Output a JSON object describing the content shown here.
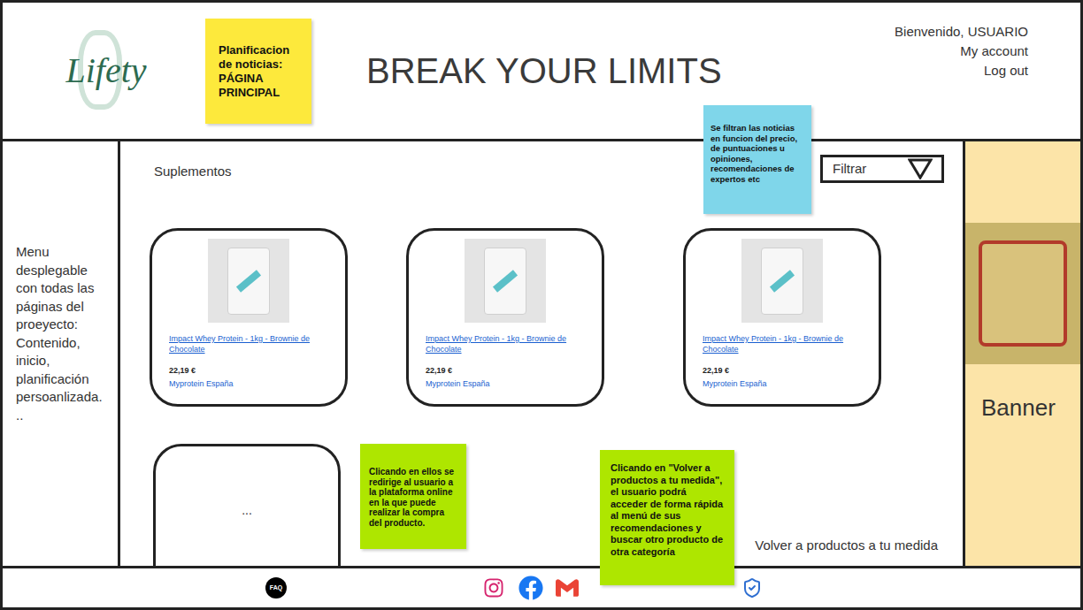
{
  "header": {
    "logo": "Lifety",
    "note": "Planificacion de noticias: PÁGINA PRINCIPAL",
    "title": "BREAK YOUR LIMITS",
    "user_menu": [
      "Bienvenido, USUARIO",
      "My account",
      "Log out"
    ]
  },
  "sidebar": {
    "text": "Menu desplegable con todas las páginas del proeyecto: Contenido, inicio, planificación persoanlizada. .."
  },
  "main": {
    "section": "Suplementos",
    "filter": {
      "label": "Filtrar"
    },
    "filter_note": "Se filtran las noticias en funcion del precio, de puntuaciones u opiniones, recomendaciones de expertos etc",
    "products": [
      {
        "name": "Impact Whey Protein - 1kg - Brownie de Chocolate",
        "price": "22,19 €",
        "seller": "Myprotein España"
      },
      {
        "name": "Impact Whey Protein - 1kg - Brownie de Chocolate",
        "price": "22,19 €",
        "seller": "Myprotein España"
      },
      {
        "name": "Impact Whey Protein - 1kg - Brownie de Chocolate",
        "price": "22,19 €",
        "seller": "Myprotein España"
      }
    ],
    "more_card": "...",
    "click_note": "Clicando en ellos se redirige al usuario a la plataforma online en la que puede realizar la compra del producto.",
    "back_link": "Volver a productos a tu medida",
    "back_note": "Clicando en \"Volver a productos a tu medida\", el usuario podrá acceder de forma rápida al menú de sus recomendaciones y buscar otro producto de otra categoría"
  },
  "banner": {
    "label": "Banner"
  },
  "footer": {
    "faq": "FAQ"
  }
}
